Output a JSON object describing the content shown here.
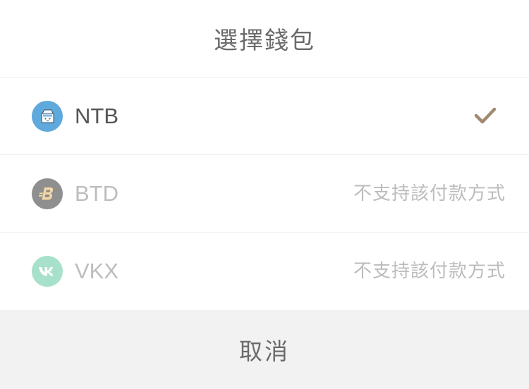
{
  "dialog": {
    "title": "選擇錢包",
    "cancel_label": "取消"
  },
  "wallets": [
    {
      "name": "NTB",
      "icon": "milk-carton-icon",
      "icon_color": "#5fa9dd",
      "selected": true,
      "supported": true,
      "status_icon": "checkmark-icon",
      "status_color": "#a08a6f"
    },
    {
      "name": "BTD",
      "icon": "btd-coin-icon",
      "icon_color": "#8f8f8f",
      "selected": false,
      "supported": false,
      "note": "不支持該付款方式"
    },
    {
      "name": "VKX",
      "icon": "vk-logo-icon",
      "icon_color": "#a8e1cb",
      "selected": false,
      "supported": false,
      "note": "不支持該付款方式"
    }
  ],
  "colors": {
    "divider": "#efefef",
    "cancel_background": "#f2f2f2",
    "disabled_text": "#bdbdbd"
  }
}
